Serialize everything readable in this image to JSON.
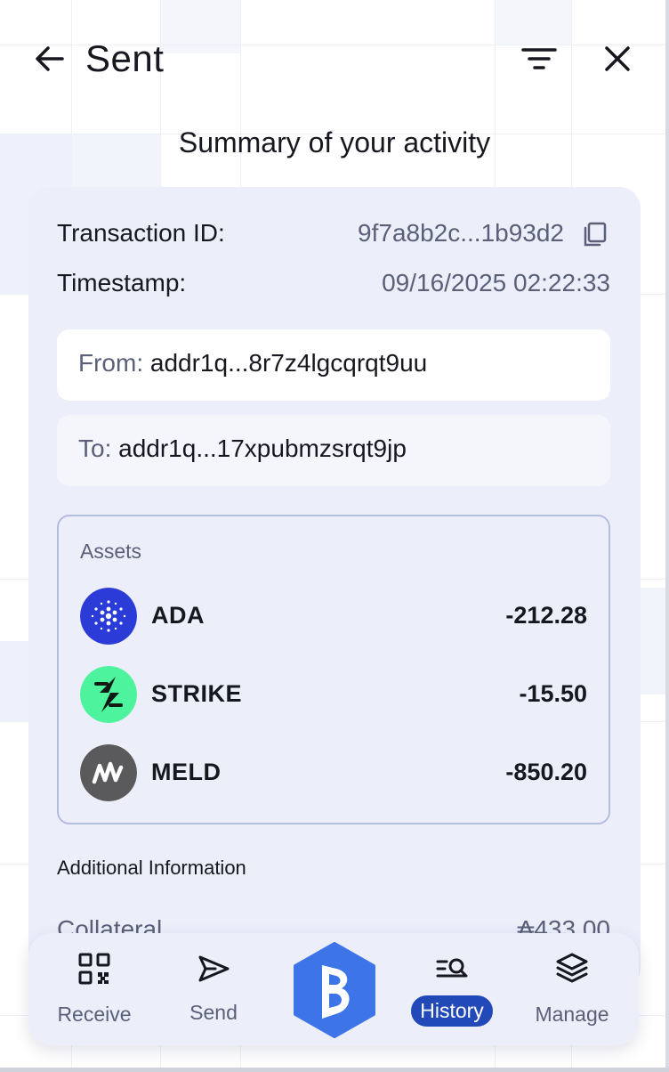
{
  "header": {
    "title": "Sent"
  },
  "subtitle": "Summary of your activity",
  "transaction": {
    "id_label": "Transaction ID:",
    "id_value": "9f7a8b2c...1b93d2",
    "timestamp_label": "Timestamp:",
    "timestamp_value": "09/16/2025 02:22:33",
    "from_label": "From:",
    "from_value": "addr1q...8r7z4lgcqrqt9uu",
    "to_label": "To:",
    "to_value": "addr1q...17xpubmzsrqt9jp"
  },
  "assets": {
    "heading": "Assets",
    "items": [
      {
        "name": "ADA",
        "amount": "-212.28",
        "icon": "cardano-icon",
        "color": "#2a3bd8"
      },
      {
        "name": "STRIKE",
        "amount": "-15.50",
        "icon": "strike-icon",
        "color": "#4ef39d"
      },
      {
        "name": "MELD",
        "amount": "-850.20",
        "icon": "meld-icon",
        "color": "#5a5a5c"
      }
    ]
  },
  "additional": {
    "heading": "Additional Information",
    "collateral_label": "Collateral",
    "collateral_value": "₳433.00"
  },
  "nav": {
    "items": [
      {
        "label": "Receive",
        "icon": "qr-code-icon"
      },
      {
        "label": "Send",
        "icon": "send-icon"
      },
      {
        "label": "History",
        "icon": "history-icon",
        "active": true
      },
      {
        "label": "Manage",
        "icon": "layers-icon"
      }
    ],
    "center_icon": "brand-logo-icon"
  },
  "colors": {
    "accent": "#2249b8",
    "brand": "#3d74e8",
    "card_bg": "#eceefa"
  }
}
